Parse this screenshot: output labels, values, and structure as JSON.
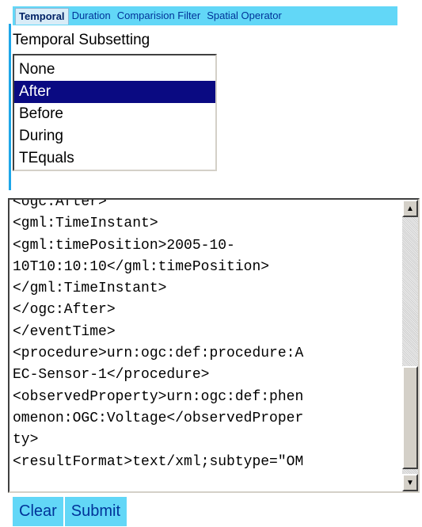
{
  "tabs": [
    {
      "label": "Temporal",
      "active": true
    },
    {
      "label": "Duration",
      "active": false
    },
    {
      "label": "Comparision Filter",
      "active": false
    },
    {
      "label": "Spatial Operator",
      "active": false
    }
  ],
  "section_title": "Temporal Subsetting",
  "temporal_options": [
    {
      "label": "None",
      "selected": false
    },
    {
      "label": "After",
      "selected": true
    },
    {
      "label": "Before",
      "selected": false
    },
    {
      "label": "During",
      "selected": false
    },
    {
      "label": "TEquals",
      "selected": false
    }
  ],
  "xml_lines": [
    "<ogc:After>",
    "<gml:TimeInstant>",
    "<gml:timePosition>2005-10-",
    "10T10:10:10</gml:timePosition>",
    "</gml:TimeInstant>",
    "</ogc:After>",
    "</eventTime>",
    "<procedure>urn:ogc:def:procedure:A",
    "EC-Sensor-1</procedure>",
    "<observedProperty>urn:ogc:def:phen",
    "omenon:OGC:Voltage</observedProper",
    "ty>",
    "<resultFormat>text/xml;subtype=\"OM"
  ],
  "buttons": {
    "clear_label": "Clear",
    "submit_label": "Submit"
  },
  "colors": {
    "accent": "#62d7f7",
    "selection": "#0a0a82",
    "link_text": "#003399"
  }
}
